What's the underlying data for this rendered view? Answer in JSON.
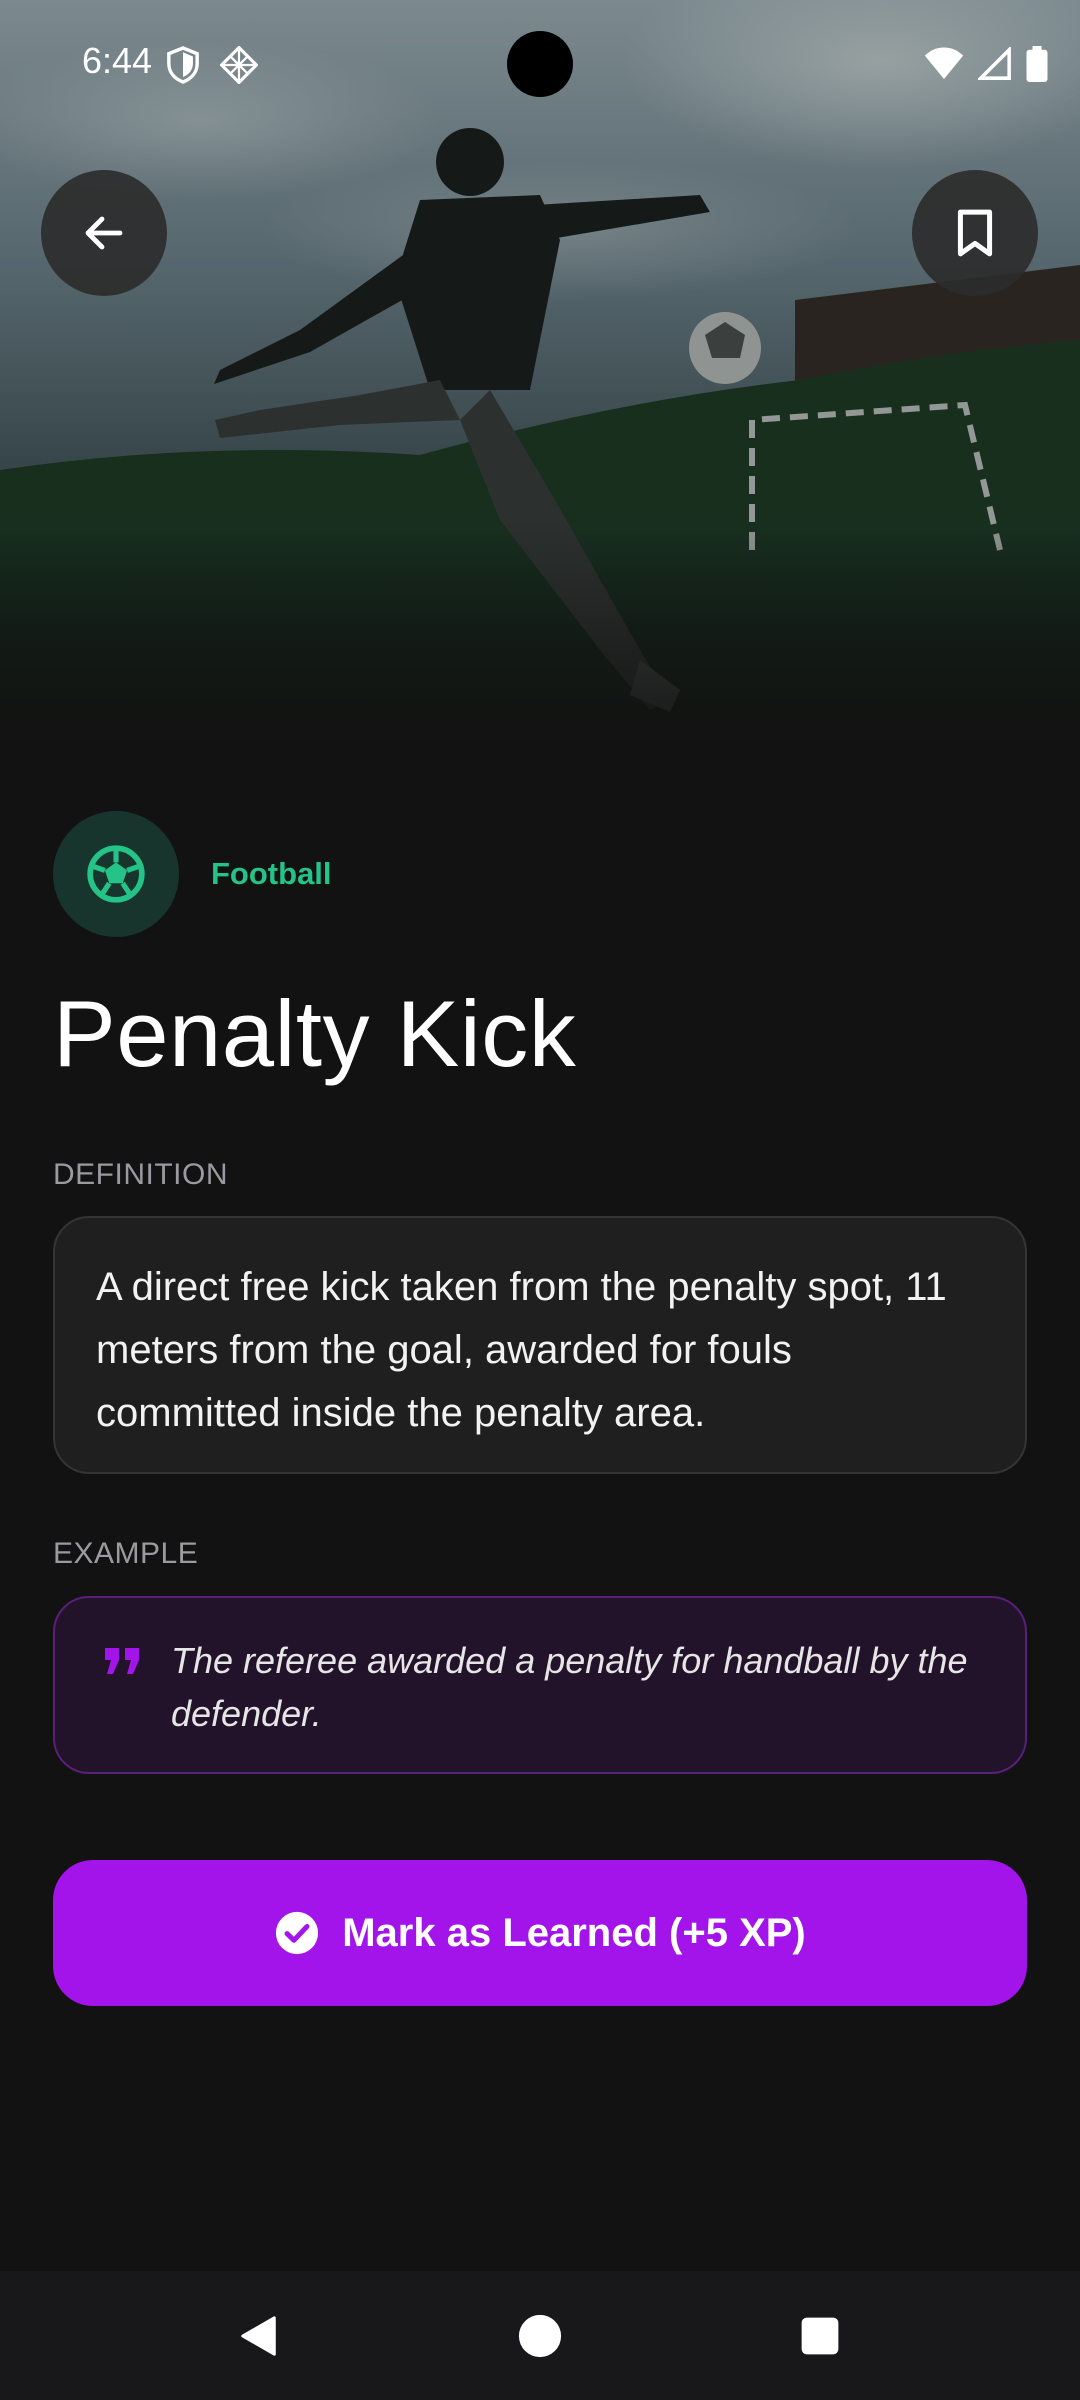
{
  "status_bar": {
    "time": "6:44",
    "icons": [
      "shield-icon",
      "diamond-grid-icon",
      "wifi-icon",
      "signal-icon",
      "battery-icon"
    ]
  },
  "hero": {
    "image": "football-player-kicking-ball-photo",
    "back_icon": "arrow-left-icon",
    "bookmark_icon": "bookmark-icon"
  },
  "category": {
    "icon": "soccer-ball-icon",
    "label": "Football",
    "color": "#24c489"
  },
  "term": {
    "title": "Penalty Kick"
  },
  "definition": {
    "label": "DEFINITION",
    "text": "A direct free kick taken from the penalty spot, 11 meters from the goal, awarded for fouls committed inside the penalty area."
  },
  "example": {
    "label": "EXAMPLE",
    "icon": "quote-icon",
    "text": "The referee awarded a penalty for handball by the defender."
  },
  "action": {
    "icon": "check-circle-icon",
    "label": "Mark as Learned (+5 XP)",
    "color": "#a314ea"
  },
  "nav_bar": {
    "icons": [
      "nav-back-icon",
      "nav-home-icon",
      "nav-recents-icon"
    ]
  }
}
